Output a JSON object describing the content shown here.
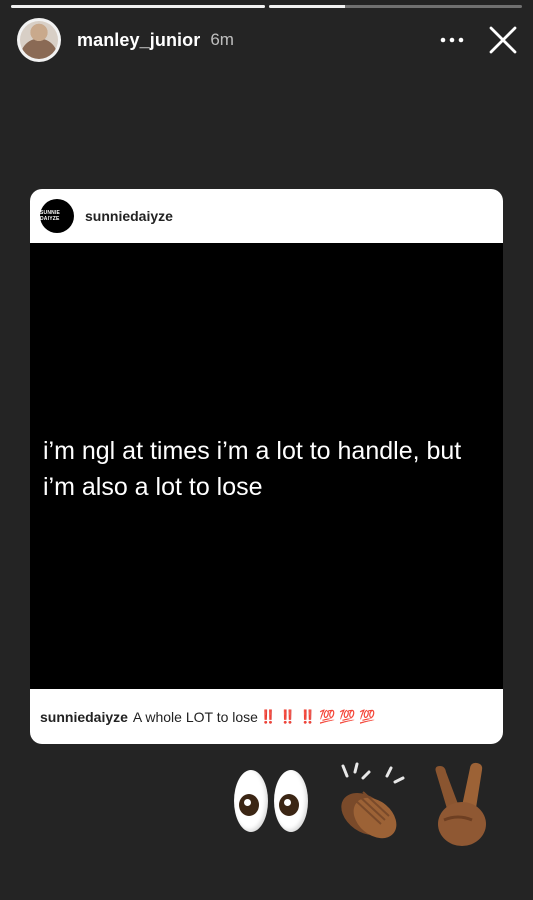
{
  "story": {
    "progress": [
      1.0,
      0.3
    ]
  },
  "header": {
    "username": "manley_junior",
    "time": "6m",
    "more_icon": "more-dots-icon",
    "close_icon": "close-icon"
  },
  "post": {
    "username": "sunniedaiyze",
    "avatar_text": "SUNNIE DAIYZE",
    "quote": "i’m ngl at times i’m a lot to handle, but i’m also a lot to lose",
    "caption": {
      "username": "sunniedaiyze",
      "text": "A whole LOT to lose",
      "emojis": "‼️ ‼️ ‼️ 💯 💯 💯"
    }
  },
  "stickers": [
    "eyes",
    "clapping-hands",
    "victory-hand"
  ]
}
